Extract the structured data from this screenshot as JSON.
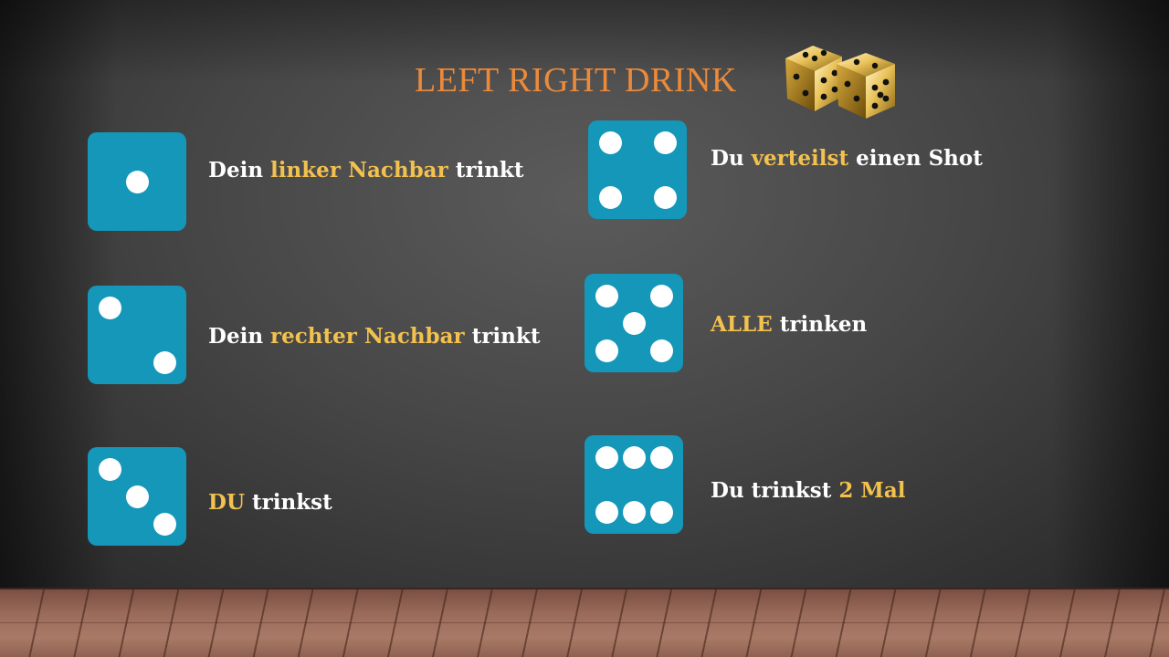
{
  "slide": {
    "title": "LEFT RIGHT DRINK",
    "title_color": "#ec8a3a",
    "highlight_color": "#f2c14e",
    "die_color": "#1497b9",
    "decoration_icon": "golden-dice-icon"
  },
  "rules": [
    {
      "die_value": 1,
      "parts": [
        "Dein ",
        "linker Nachbar",
        " trinkt"
      ]
    },
    {
      "die_value": 2,
      "parts": [
        "Dein ",
        "rechter Nachbar",
        " trinkt"
      ]
    },
    {
      "die_value": 3,
      "parts": [
        "",
        "DU",
        " trinkst"
      ]
    },
    {
      "die_value": 4,
      "parts": [
        "Du ",
        "verteilst",
        " einen Shot"
      ]
    },
    {
      "die_value": 5,
      "parts": [
        "",
        "ALLE",
        " trinken"
      ]
    },
    {
      "die_value": 6,
      "parts": [
        "Du trinkst ",
        "2 Mal",
        ""
      ]
    }
  ]
}
